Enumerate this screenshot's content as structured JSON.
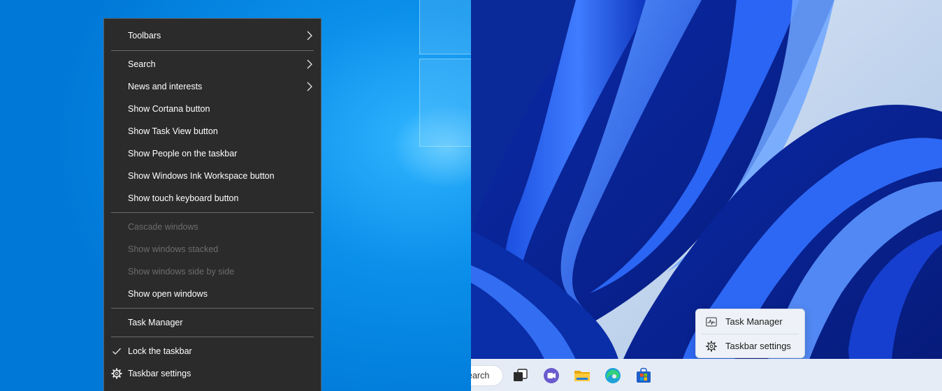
{
  "win10_menu": {
    "toolbars": "Toolbars",
    "search": "Search",
    "news": "News and interests",
    "cortana": "Show Cortana button",
    "task_view": "Show Task View button",
    "people": "Show People on the taskbar",
    "ink": "Show Windows Ink Workspace button",
    "touch_keyboard": "Show touch keyboard button",
    "cascade": "Cascade windows",
    "stacked": "Show windows stacked",
    "side_by_side": "Show windows side by side",
    "open_windows": "Show open windows",
    "task_manager": "Task Manager",
    "lock_taskbar": "Lock the taskbar",
    "taskbar_settings": "Taskbar settings"
  },
  "win11_menu": {
    "task_manager": "Task Manager",
    "taskbar_settings": "Taskbar settings"
  },
  "win11_taskbar": {
    "search_text": "earch"
  },
  "icons": {
    "chevron": "chevron-right-icon",
    "check": "checkmark-icon",
    "gear": "gear-icon",
    "pulse": "task-manager-icon",
    "task_view": "task-view-icon",
    "chat": "teams-chat-icon",
    "explorer": "file-explorer-icon",
    "edge": "edge-icon",
    "store": "store-icon"
  },
  "colors": {
    "win10_bg": "#0078d7",
    "menu_dark": "#2b2b2b",
    "disabled_text": "#6d6d6d",
    "win11_menu": "#eef2f8"
  }
}
